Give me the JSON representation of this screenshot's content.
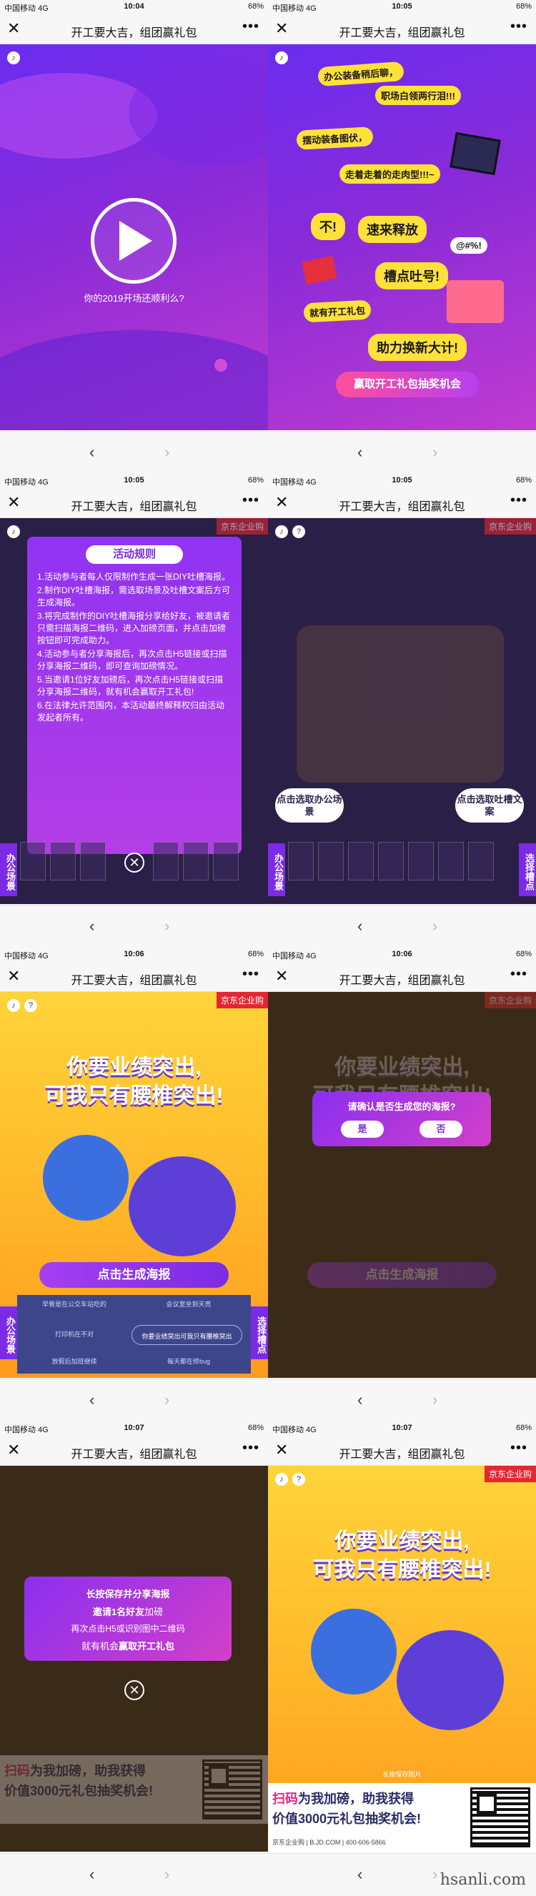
{
  "nav": {
    "close_glyph": "✕",
    "title": "开工要大吉，组团赢礼包",
    "more_glyph": "•••",
    "back_glyph": "‹",
    "forward_glyph": "›"
  },
  "status_bars": [
    {
      "carrier": "中国移动  4G",
      "time": "10:04",
      "battery": "68%"
    },
    {
      "carrier": "中国移动  4G",
      "time": "10:05",
      "battery": "68%"
    },
    {
      "carrier": "中国移动  4G",
      "time": "10:05",
      "battery": "68%"
    },
    {
      "carrier": "中国移动  4G",
      "time": "10:05",
      "battery": "68%"
    },
    {
      "carrier": "中国移动  4G",
      "time": "10:06",
      "battery": "68%"
    },
    {
      "carrier": "中国移动  4G",
      "time": "10:06",
      "battery": "68%"
    },
    {
      "carrier": "中国移动  4G",
      "time": "10:07",
      "battery": "68%"
    },
    {
      "carrier": "中国移动  4G",
      "time": "10:07",
      "battery": "68%"
    }
  ],
  "screen1": {
    "caption": "你的2019开场还顺利么?"
  },
  "screen2": {
    "stickers": [
      "办公装备稍后聊，",
      "职场白领两行泪!!!",
      "摆动装备图伏，",
      "走着走着的走肉型!!!~",
      "不!",
      "速来释放",
      "@#%!",
      "槽点吐号!",
      "就有开工礼包",
      "助力换新大计!"
    ],
    "cta": "赢取开工礼包抽奖机会"
  },
  "screen3": {
    "rules_title": "活动规则",
    "rules": [
      "1.活动参与者每人仅限制作生成一张DIY吐槽海报。",
      "2.制作DIY吐槽海报，需选取场景及吐槽文案后方可生成海报。",
      "3.将完成制作的DIY吐槽海报分享给好友，被邀请者只需扫描海报二维码，进入加磅页面，并点击加磅按钮即可完成助力。",
      "4.活动参与者分享海报后，再次点击H5链接或扫描分享海报二维码，即可查询加磅情况。",
      "5.当邀请1位好友加磅后，再次点击H5链接或扫描分享海报二维码，就有机会赢取开工礼包!",
      "6.在法律允许范围内，本活动最终解释权归由活动发起者所有。"
    ],
    "jd_badge": "京东企业购",
    "side_left": "办公场景",
    "close_glyph": "✕"
  },
  "screen4": {
    "jd_badge": "京东企业购",
    "bubble_left": "点击选取办公场景",
    "bubble_right": "点击选取吐槽文案",
    "side_left": "办公场景",
    "side_right": "选择槽点"
  },
  "screen5": {
    "jd_badge": "京东企业购",
    "headline_1": "你要业绩突出,",
    "headline_2": "可我只有腰椎突出!",
    "gen_button": "点击生成海报",
    "side_left": "办公场景",
    "side_right": "选择槽点",
    "options": [
      "早餐是在公交车站吃的",
      "会议室坐到天亮",
      "打印机在不对",
      "放假后加班继续",
      "你要业绩突出可我只有腰椎突出",
      "每天都在修bug"
    ]
  },
  "screen6": {
    "question": "请确认是否生成您的海报?",
    "yes": "是",
    "no": "否"
  },
  "screen7": {
    "line1": "长按保存并分享海报",
    "line2_a": "邀请1名好友",
    "line2_b": "加磅",
    "line3": "再次点击H5或识别图中二维码",
    "line4_a": "就有机会",
    "line4_b": "赢取开工礼包",
    "close_glyph": "✕",
    "promo_1a": "扫码",
    "promo_1b": "为我加磅，助我获得",
    "promo_2": "价值3000元礼包抽奖机会!"
  },
  "screen8": {
    "jd_badge": "京东企业购",
    "headline_1": "你要业绩突出,",
    "headline_2": "可我只有腰椎突出!",
    "caption_small": "长按保存图片",
    "promo_1a": "扫码",
    "promo_1b": "为我加磅，助我获得",
    "promo_2": "价值3000元礼包抽奖机会!",
    "promo_foot": "京东企业购 | B.JD.COM | 400-606-5866"
  },
  "watermark": "hsanli.com",
  "colors": {
    "purple": "#7b2be6",
    "pink": "#e02a82",
    "jd_red": "#e4262f",
    "yellow": "#ffd43a"
  }
}
